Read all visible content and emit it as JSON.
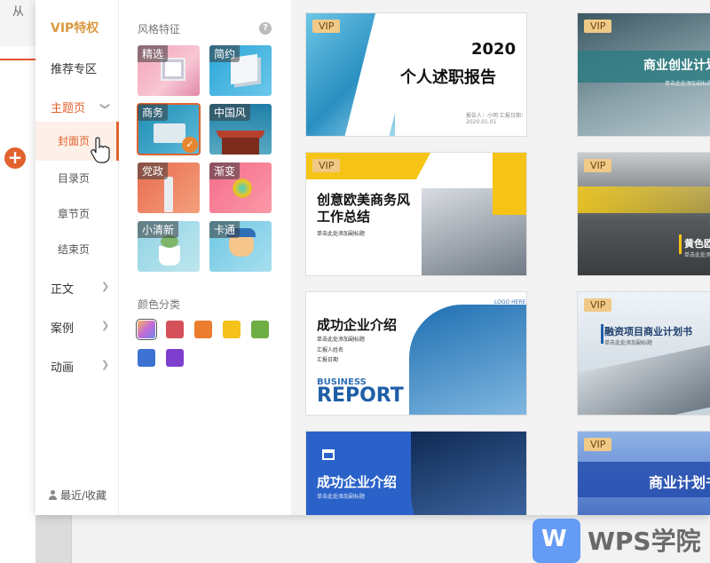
{
  "background": {
    "top_text": "从"
  },
  "nav": {
    "vip": "VIP特权",
    "recommend": "推荐专区",
    "theme_page": "主题页",
    "sub_items": [
      "封面页",
      "目录页",
      "章节页",
      "结束页"
    ],
    "body_text": "正文",
    "cases": "案例",
    "animation": "动画",
    "favorites": "最近/收藏"
  },
  "filters": {
    "style_title": "风格特征",
    "styles": [
      "精选",
      "简约",
      "商务",
      "中国风",
      "党政",
      "渐变",
      "小清新",
      "卡通"
    ],
    "selected_style": "商务",
    "color_title": "颜色分类",
    "colors": [
      "#c46bd6",
      "#d4505a",
      "#ea7d2e",
      "#f4c21a",
      "#6fae45",
      "#3d72d2",
      "#7e3fcf"
    ]
  },
  "templates": [
    {
      "vip": "VIP",
      "title_year": "2020",
      "title": "个人述职报告",
      "meta": "报告人：小明  汇报日期：2020.01.01"
    },
    {
      "vip": "VIP",
      "title": "商业创业计划书",
      "subtitle": "单击此处添加副标题"
    },
    {
      "vip": "VIP",
      "title_line1": "创意欧美商务风",
      "title_line2": "工作总结",
      "subtitle": "单击此处添加副标题"
    },
    {
      "vip": "VIP",
      "title": "黄色欧美风工",
      "subtitle": "单击此处添加副标题"
    },
    {
      "title": "成功企业介绍",
      "subtitle": "单击此处添加副标题",
      "line2": "汇报人姓名",
      "line3": "汇报日期",
      "logo": "LOGO HERE",
      "en1": "BUSINESS",
      "en2": "REPORT"
    },
    {
      "vip": "VIP",
      "title": "融资项目商业计划书",
      "subtitle": "单击此处添加副标题"
    },
    {
      "title": "成功企业介绍",
      "subtitle": "单击此处添加副标题"
    },
    {
      "vip": "VIP",
      "title": "商业计划书"
    }
  ],
  "watermark": {
    "logo": "W",
    "text": "WPS学院"
  }
}
